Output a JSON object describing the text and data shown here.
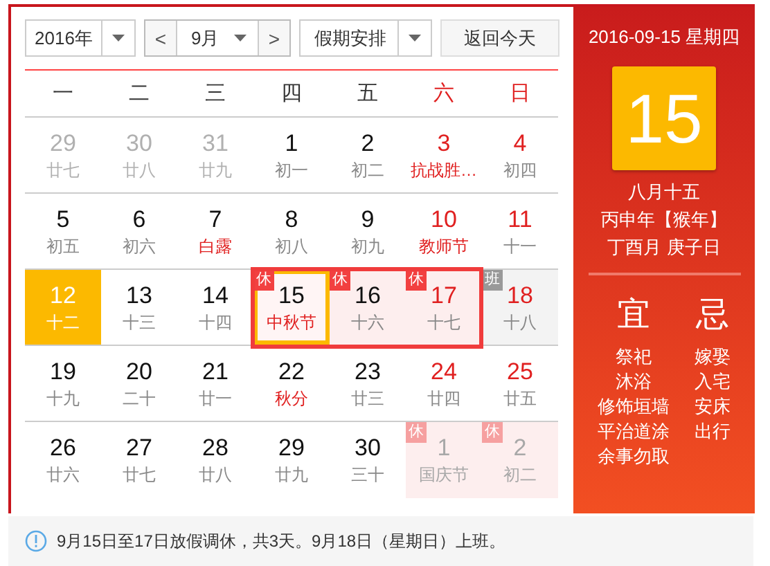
{
  "toolbar": {
    "year": "2016年",
    "prev": "<",
    "month": "9月",
    "next": ">",
    "holiday": "假期安排",
    "today_button": "返回今天"
  },
  "weekdays": [
    {
      "label": "一",
      "weekend": false
    },
    {
      "label": "二",
      "weekend": false
    },
    {
      "label": "三",
      "weekend": false
    },
    {
      "label": "四",
      "weekend": false
    },
    {
      "label": "五",
      "weekend": false
    },
    {
      "label": "六",
      "weekend": true
    },
    {
      "label": "日",
      "weekend": true
    }
  ],
  "weeks": [
    [
      {
        "day": "29",
        "lunar": "廿七",
        "kind": "prev",
        "red": false,
        "festival": false,
        "today": false,
        "selected": false,
        "highlighted": false
      },
      {
        "day": "30",
        "lunar": "廿八",
        "kind": "prev",
        "red": false,
        "festival": false,
        "today": false,
        "selected": false,
        "highlighted": false
      },
      {
        "day": "31",
        "lunar": "廿九",
        "kind": "prev",
        "red": false,
        "festival": false,
        "today": false,
        "selected": false,
        "highlighted": false
      },
      {
        "day": "1",
        "lunar": "初一",
        "kind": "current",
        "red": false,
        "festival": false,
        "today": false,
        "selected": false,
        "highlighted": false
      },
      {
        "day": "2",
        "lunar": "初二",
        "kind": "current",
        "red": false,
        "festival": false,
        "today": false,
        "selected": false,
        "highlighted": false
      },
      {
        "day": "3",
        "lunar": "抗战胜…",
        "kind": "current",
        "red": true,
        "festival": true,
        "today": false,
        "selected": false,
        "highlighted": false
      },
      {
        "day": "4",
        "lunar": "初四",
        "kind": "current",
        "red": true,
        "festival": false,
        "today": false,
        "selected": false,
        "highlighted": false
      }
    ],
    [
      {
        "day": "5",
        "lunar": "初五",
        "kind": "current",
        "red": false,
        "festival": false,
        "today": false,
        "selected": false,
        "highlighted": false
      },
      {
        "day": "6",
        "lunar": "初六",
        "kind": "current",
        "red": false,
        "festival": false,
        "today": false,
        "selected": false,
        "highlighted": false
      },
      {
        "day": "7",
        "lunar": "白露",
        "kind": "current",
        "red": false,
        "festival": true,
        "today": false,
        "selected": false,
        "highlighted": false
      },
      {
        "day": "8",
        "lunar": "初八",
        "kind": "current",
        "red": false,
        "festival": false,
        "today": false,
        "selected": false,
        "highlighted": false
      },
      {
        "day": "9",
        "lunar": "初九",
        "kind": "current",
        "red": false,
        "festival": false,
        "today": false,
        "selected": false,
        "highlighted": false
      },
      {
        "day": "10",
        "lunar": "教师节",
        "kind": "current",
        "red": true,
        "festival": true,
        "today": false,
        "selected": false,
        "highlighted": false
      },
      {
        "day": "11",
        "lunar": "十一",
        "kind": "current",
        "red": true,
        "festival": false,
        "today": false,
        "selected": false,
        "highlighted": false
      }
    ],
    [
      {
        "day": "12",
        "lunar": "十二",
        "kind": "current",
        "red": false,
        "festival": false,
        "today": true,
        "selected": false,
        "highlighted": false
      },
      {
        "day": "13",
        "lunar": "十三",
        "kind": "current",
        "red": false,
        "festival": false,
        "today": false,
        "selected": false,
        "highlighted": false
      },
      {
        "day": "14",
        "lunar": "十四",
        "kind": "current",
        "red": false,
        "festival": false,
        "today": false,
        "selected": false,
        "highlighted": false
      },
      {
        "day": "15",
        "lunar": "中秋节",
        "kind": "current",
        "red": false,
        "festival": true,
        "today": false,
        "selected": true,
        "highlighted": true,
        "badge": {
          "text": "休",
          "kind": "rest"
        }
      },
      {
        "day": "16",
        "lunar": "十六",
        "kind": "current",
        "red": false,
        "festival": false,
        "today": false,
        "selected": false,
        "highlighted": true,
        "badge": {
          "text": "休",
          "kind": "rest"
        }
      },
      {
        "day": "17",
        "lunar": "十七",
        "kind": "current",
        "red": true,
        "festival": false,
        "today": false,
        "selected": false,
        "highlighted": true,
        "badge": {
          "text": "休",
          "kind": "rest"
        }
      },
      {
        "day": "18",
        "lunar": "十八",
        "kind": "current",
        "red": true,
        "festival": false,
        "today": false,
        "selected": false,
        "highlighted": false,
        "badge": {
          "text": "班",
          "kind": "work"
        }
      }
    ],
    [
      {
        "day": "19",
        "lunar": "十九",
        "kind": "current",
        "red": false,
        "festival": false,
        "today": false,
        "selected": false,
        "highlighted": false
      },
      {
        "day": "20",
        "lunar": "二十",
        "kind": "current",
        "red": false,
        "festival": false,
        "today": false,
        "selected": false,
        "highlighted": false
      },
      {
        "day": "21",
        "lunar": "廿一",
        "kind": "current",
        "red": false,
        "festival": false,
        "today": false,
        "selected": false,
        "highlighted": false
      },
      {
        "day": "22",
        "lunar": "秋分",
        "kind": "current",
        "red": false,
        "festival": true,
        "today": false,
        "selected": false,
        "highlighted": false
      },
      {
        "day": "23",
        "lunar": "廿三",
        "kind": "current",
        "red": false,
        "festival": false,
        "today": false,
        "selected": false,
        "highlighted": false
      },
      {
        "day": "24",
        "lunar": "廿四",
        "kind": "current",
        "red": true,
        "festival": false,
        "today": false,
        "selected": false,
        "highlighted": false
      },
      {
        "day": "25",
        "lunar": "廿五",
        "kind": "current",
        "red": true,
        "festival": false,
        "today": false,
        "selected": false,
        "highlighted": false
      }
    ],
    [
      {
        "day": "26",
        "lunar": "廿六",
        "kind": "current",
        "red": false,
        "festival": false,
        "today": false,
        "selected": false,
        "highlighted": false
      },
      {
        "day": "27",
        "lunar": "廿七",
        "kind": "current",
        "red": false,
        "festival": false,
        "today": false,
        "selected": false,
        "highlighted": false
      },
      {
        "day": "28",
        "lunar": "廿八",
        "kind": "current",
        "red": false,
        "festival": false,
        "today": false,
        "selected": false,
        "highlighted": false
      },
      {
        "day": "29",
        "lunar": "廿九",
        "kind": "current",
        "red": false,
        "festival": false,
        "today": false,
        "selected": false,
        "highlighted": false
      },
      {
        "day": "30",
        "lunar": "三十",
        "kind": "current",
        "red": false,
        "festival": false,
        "today": false,
        "selected": false,
        "highlighted": false
      },
      {
        "day": "1",
        "lunar": "国庆节",
        "kind": "next",
        "red": false,
        "festival": false,
        "today": false,
        "selected": false,
        "highlighted": false,
        "badge": {
          "text": "休",
          "kind": "rest"
        }
      },
      {
        "day": "2",
        "lunar": "初二",
        "kind": "next",
        "red": false,
        "festival": false,
        "today": false,
        "selected": false,
        "highlighted": false,
        "badge": {
          "text": "休",
          "kind": "rest"
        }
      }
    ]
  ],
  "detail": {
    "date": "2016-09-15 星期四",
    "day": "15",
    "lunar_lines": [
      "八月十五",
      "丙申年【猴年】",
      "丁酉月 庚子日"
    ],
    "good": {
      "title": "宜",
      "items": [
        "祭祀",
        "沐浴",
        "修饰垣墙",
        "平治道涂",
        "余事勿取"
      ]
    },
    "bad": {
      "title": "忌",
      "items": [
        "嫁娶",
        "入宅",
        "安床",
        "出行"
      ]
    }
  },
  "notice": "9月15日至17日放假调休，共3天。9月18日（星期日）上班。"
}
